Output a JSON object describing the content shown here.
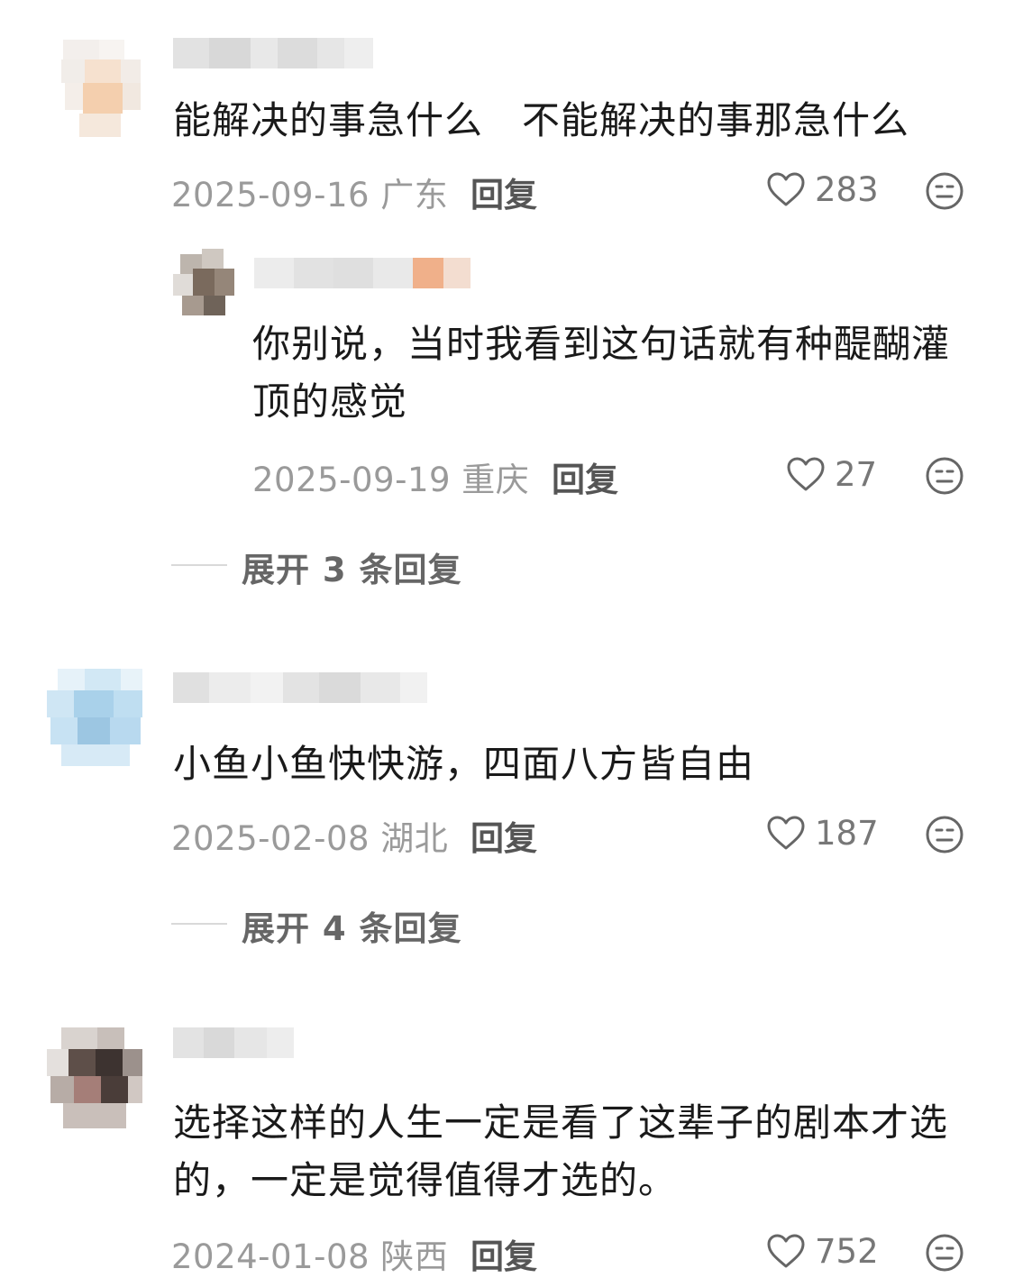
{
  "comments": [
    {
      "text": "能解决的事急什么   不能解决的事那急什么",
      "date": "2025-09-16",
      "location": "广东",
      "reply_label": "回复",
      "likes": "283",
      "replies": [
        {
          "text": "你别说，当时我看到这句话就有种醍醐灌顶的感觉",
          "date": "2025-09-19",
          "location": "重庆",
          "reply_label": "回复",
          "likes": "27"
        }
      ],
      "expand_label": "展开 3 条回复"
    },
    {
      "text": "小鱼小鱼快快游，四面八方皆自由",
      "date": "2025-02-08",
      "location": "湖北",
      "reply_label": "回复",
      "likes": "187",
      "expand_label": "展开 4 条回复"
    },
    {
      "text": "选择这样的人生一定是看了这辈子的剧本才选的，一定是觉得值得才选的。",
      "date": "2024-01-08",
      "location": "陕西",
      "reply_label": "回复",
      "likes": "752"
    }
  ],
  "icons": {
    "like": "heart-outline-icon",
    "emoji": "neutral-face-icon"
  },
  "colors": {
    "text": "#1a1a1a",
    "meta": "#9a9a9a",
    "reply": "#555555"
  }
}
